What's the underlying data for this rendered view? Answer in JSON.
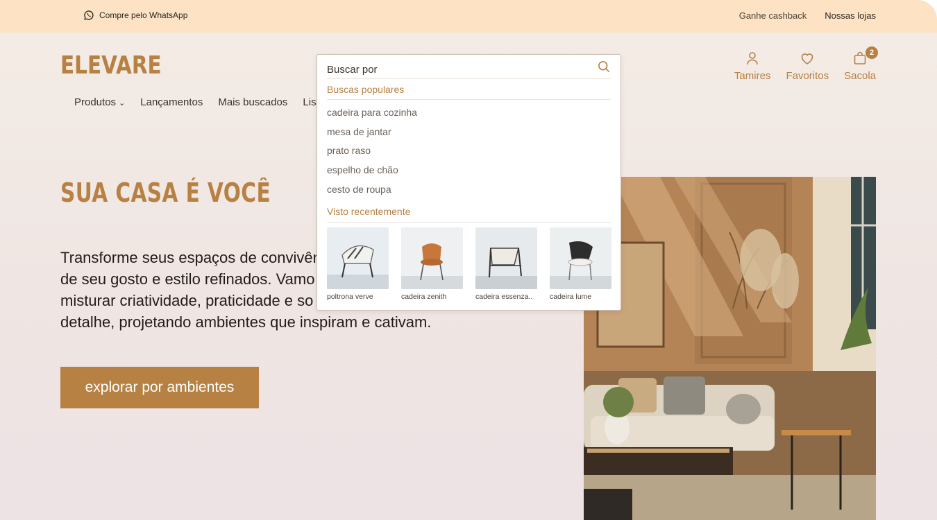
{
  "topbar": {
    "whatsapp_label": "Compre pelo WhatsApp",
    "links": [
      "Ganhe cashback",
      "Nossas lojas"
    ]
  },
  "header": {
    "logo": "ELEVARE",
    "nav": [
      "Produtos",
      "Lançamentos",
      "Mais buscados",
      "Lis"
    ],
    "icons": [
      {
        "label": "Tamires",
        "icon": "user-icon"
      },
      {
        "label": "Favoritos",
        "icon": "heart-icon"
      },
      {
        "label": "Sacola",
        "icon": "bag-icon",
        "badge": "2"
      }
    ]
  },
  "hero": {
    "title": "SUA CASA É VOCÊ",
    "text_lines": [
      "Transforme seus espaços de convivên",
      "de seu gosto e estilo refinados. Vamo",
      "misturar criatividade, praticidade e so",
      "detalhe, projetando ambientes que inspiram e cativam."
    ],
    "cta": "explorar por ambientes"
  },
  "search": {
    "placeholder": "Buscar por",
    "popular_heading": "Buscas populares",
    "popular": [
      "cadeira para cozinha",
      "mesa de jantar",
      "prato raso",
      "espelho de chão",
      "cesto de roupa"
    ],
    "recent_heading": "Visto recentemente",
    "recent": [
      "poltrona verve",
      "cadeira zenith",
      "cadeira essenza..",
      "cadeira lume"
    ]
  },
  "colors": {
    "accent": "#b88144",
    "topbar": "#fde3c3",
    "background": "#f1e8e4"
  }
}
